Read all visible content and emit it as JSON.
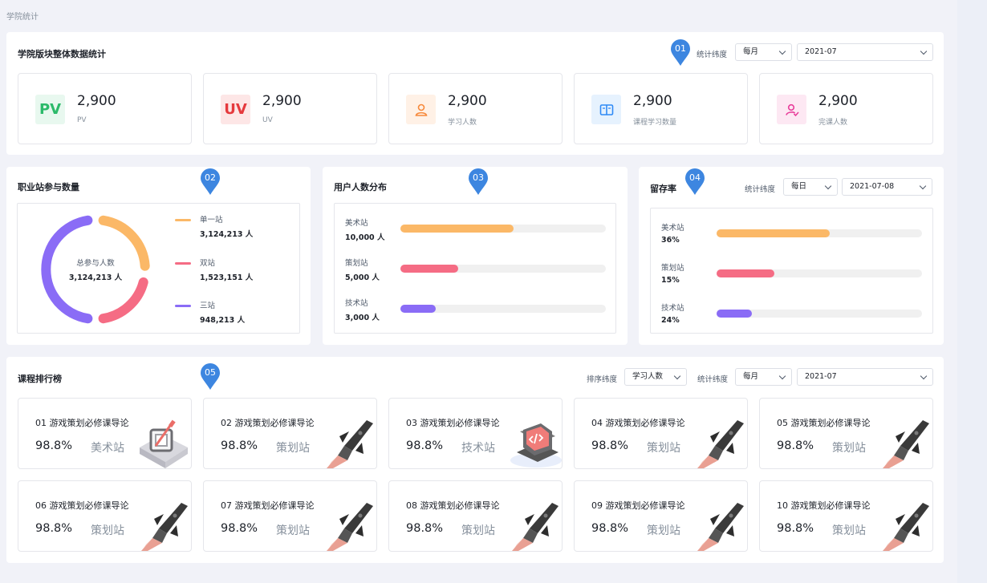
{
  "breadcrumb": "学院统计",
  "overview": {
    "title": "学院版块整体数据统计",
    "marker": "01",
    "dimension_label": "统计纬度",
    "period": "每月",
    "date": "2021-07",
    "stats": [
      {
        "icon": "pv-icon",
        "icon_text": "PV",
        "value": "2,900",
        "label": "PV"
      },
      {
        "icon": "uv-icon",
        "icon_text": "UV",
        "value": "2,900",
        "label": "UV"
      },
      {
        "icon": "user-icon",
        "value": "2,900",
        "label": "学习人数"
      },
      {
        "icon": "book-icon",
        "value": "2,900",
        "label": "课程学习数量"
      },
      {
        "icon": "user-check-icon",
        "value": "2,900",
        "label": "完课人数"
      }
    ]
  },
  "participation": {
    "title": "职业站参与数量",
    "marker": "02",
    "center_label": "总参与人数",
    "center_value": "3,124,213 人",
    "legend": [
      {
        "name": "单一站",
        "value": "3,124,213 人",
        "color": "#fbb867"
      },
      {
        "name": "双站",
        "value": "1,523,151 人",
        "color": "#f56c84"
      },
      {
        "name": "三站",
        "value": "948,213 人",
        "color": "#8a6cf6"
      }
    ]
  },
  "distribution": {
    "title": "用户人数分布",
    "marker": "03",
    "rows": [
      {
        "name": "美术站",
        "value": "10,000 人",
        "fraction": 0.55,
        "color": "#fbb867"
      },
      {
        "name": "策划站",
        "value": "5,000 人",
        "fraction": 0.28,
        "color": "#f56c84"
      },
      {
        "name": "技术站",
        "value": "3,000 人",
        "fraction": 0.17,
        "color": "#8a6cf6"
      }
    ]
  },
  "retention": {
    "title": "留存率",
    "marker": "04",
    "dimension_label": "统计纬度",
    "period": "每日",
    "date": "2021-07-08",
    "rows": [
      {
        "name": "美术站",
        "value": "36%",
        "fraction": 0.55,
        "color": "#fbb867"
      },
      {
        "name": "策划站",
        "value": "15%",
        "fraction": 0.28,
        "color": "#f56c84"
      },
      {
        "name": "技术站",
        "value": "24%",
        "fraction": 0.17,
        "color": "#8a6cf6"
      }
    ]
  },
  "ranking": {
    "title": "课程排行榜",
    "marker": "05",
    "sort_label": "排序纬度",
    "sort_value": "学习人数",
    "dimension_label": "统计纬度",
    "period": "每月",
    "date": "2021-07",
    "courses": [
      {
        "title": "01 游戏策划必修课导论",
        "percent": "98.8%",
        "station": "美术站",
        "art": "art-icon"
      },
      {
        "title": "02 游戏策划必修课导论",
        "percent": "98.8%",
        "station": "策划站",
        "art": "rocket-icon"
      },
      {
        "title": "03 游戏策划必修课导论",
        "percent": "98.8%",
        "station": "技术站",
        "art": "code-laptop-icon"
      },
      {
        "title": "04 游戏策划必修课导论",
        "percent": "98.8%",
        "station": "策划站",
        "art": "rocket-icon"
      },
      {
        "title": "05 游戏策划必修课导论",
        "percent": "98.8%",
        "station": "策划站",
        "art": "rocket-icon"
      },
      {
        "title": "06 游戏策划必修课导论",
        "percent": "98.8%",
        "station": "策划站",
        "art": "rocket-icon"
      },
      {
        "title": "07 游戏策划必修课导论",
        "percent": "98.8%",
        "station": "策划站",
        "art": "rocket-icon"
      },
      {
        "title": "08 游戏策划必修课导论",
        "percent": "98.8%",
        "station": "策划站",
        "art": "rocket-icon"
      },
      {
        "title": "09 游戏策划必修课导论",
        "percent": "98.8%",
        "station": "策划站",
        "art": "rocket-icon"
      },
      {
        "title": "10 游戏策划必修课导论",
        "percent": "98.8%",
        "station": "策划站",
        "art": "rocket-icon"
      }
    ]
  }
}
